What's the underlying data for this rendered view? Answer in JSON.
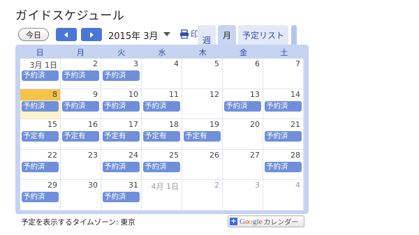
{
  "app": {
    "title": "ガイドスケジュール"
  },
  "toolbar": {
    "today_label": "今日",
    "month_label": "2015年 3月",
    "print_label": "印刷"
  },
  "tabs": {
    "week": "週",
    "month": "月",
    "agenda": "予定リスト"
  },
  "weekdays": [
    "日",
    "月",
    "火",
    "水",
    "木",
    "金",
    "土"
  ],
  "weeks": [
    [
      {
        "date": "3月 1日",
        "event": "予約済"
      },
      {
        "date": "2",
        "event": "予約済"
      },
      {
        "date": "3",
        "event": "予約済"
      },
      {
        "date": "4",
        "event": ""
      },
      {
        "date": "5",
        "event": ""
      },
      {
        "date": "6",
        "event": ""
      },
      {
        "date": "7",
        "event": ""
      }
    ],
    [
      {
        "date": "8",
        "event": "予約済",
        "today": true
      },
      {
        "date": "9",
        "event": "予約済"
      },
      {
        "date": "10",
        "event": "予約済"
      },
      {
        "date": "11",
        "event": "予約済"
      },
      {
        "date": "12",
        "event": ""
      },
      {
        "date": "13",
        "event": "予約済"
      },
      {
        "date": "14",
        "event": "予約済"
      }
    ],
    [
      {
        "date": "15",
        "event": "予定有"
      },
      {
        "date": "16",
        "event": "予定有"
      },
      {
        "date": "17",
        "event": "予定有"
      },
      {
        "date": "18",
        "event": "予定有"
      },
      {
        "date": "19",
        "event": "予定有"
      },
      {
        "date": "20",
        "event": ""
      },
      {
        "date": "21",
        "event": "予約済"
      }
    ],
    [
      {
        "date": "22",
        "event": "予約済"
      },
      {
        "date": "23",
        "event": ""
      },
      {
        "date": "24",
        "event": "予約済"
      },
      {
        "date": "25",
        "event": "予約済"
      },
      {
        "date": "26",
        "event": ""
      },
      {
        "date": "27",
        "event": ""
      },
      {
        "date": "28",
        "event": "予約済"
      }
    ],
    [
      {
        "date": "29",
        "event": "予約済"
      },
      {
        "date": "30",
        "event": ""
      },
      {
        "date": "31",
        "event": "予約済"
      },
      {
        "date": "4月 1日",
        "event": "",
        "other": true
      },
      {
        "date": "2",
        "event": "",
        "other": true
      },
      {
        "date": "3",
        "event": "",
        "other": true
      },
      {
        "date": "4",
        "event": "",
        "other": true
      }
    ]
  ],
  "footer": {
    "timezone": "予定を表示するタイムゾーン: 東京",
    "google_button": {
      "plus": "+",
      "brand": [
        "G",
        "o",
        "o",
        "g",
        "l",
        "e"
      ],
      "suffix": "カレンダー"
    }
  },
  "colors": {
    "accent": "#4a77d6",
    "event": "#6f8fdb",
    "today": "#f5c34b",
    "frame": "#c6d3f1"
  },
  "icons": {
    "prev": "chevron-left-icon",
    "next": "chevron-right-icon",
    "print": "printer-icon",
    "dropdown": "caret-down-icon"
  }
}
